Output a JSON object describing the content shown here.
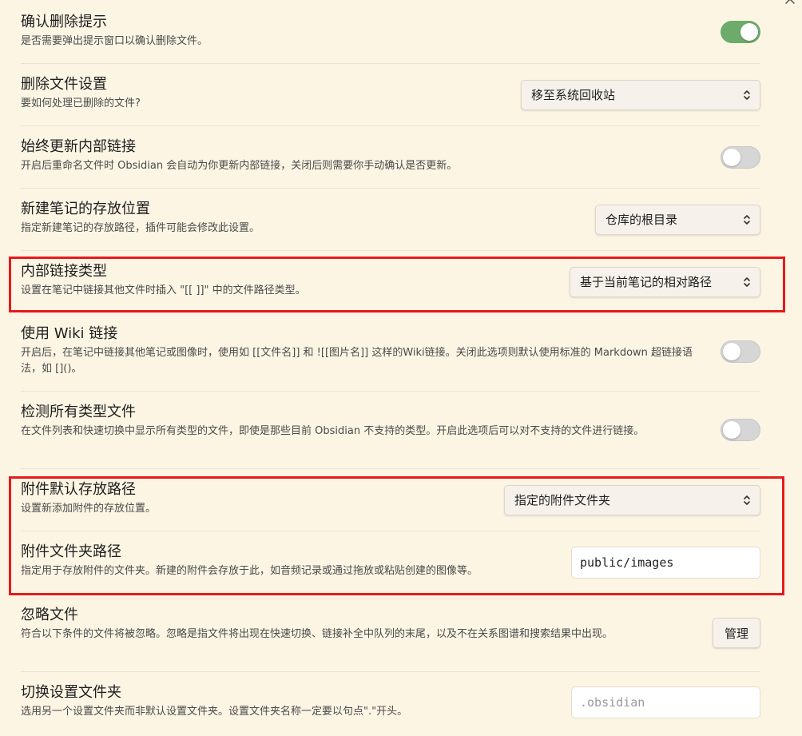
{
  "settings": [
    {
      "name": "确认删除提示",
      "desc": "是否需要弹出提示窗口以确认删除文件。",
      "control": "toggle",
      "on": true
    },
    {
      "name": "删除文件设置",
      "desc": "要如何处理已删除的文件?",
      "control": "dropdown",
      "value": "移至系统回收站"
    },
    {
      "name": "始终更新内部链接",
      "desc": "开启后重命名文件时 Obsidian 会自动为你更新内部链接，关闭后则需要你手动确认是否更新。",
      "control": "toggle",
      "on": false
    },
    {
      "name": "新建笔记的存放位置",
      "desc": "指定新建笔记的存放路径，插件可能会修改此设置。",
      "control": "dropdown",
      "value": "仓库的根目录"
    },
    {
      "name": "内部链接类型",
      "desc": "设置在笔记中链接其他文件时插入 \"[[ ]]\" 中的文件路径类型。",
      "control": "dropdown",
      "value": "基于当前笔记的相对路径"
    },
    {
      "name": "使用 Wiki 链接",
      "desc": "开启后，在笔记中链接其他笔记或图像时，使用如 [[文件名]] 和 ![[图片名]] 这样的Wiki链接。关闭此选项则默认使用标准的 Markdown 超链接语法，如 []()。",
      "control": "toggle",
      "on": false
    },
    {
      "name": "检测所有类型文件",
      "desc": "在文件列表和快速切换中显示所有类型的文件，即使是那些目前 Obsidian 不支持的类型。开启此选项后可以对不支持的文件进行链接。",
      "control": "toggle",
      "on": false
    },
    {
      "name": "附件默认存放路径",
      "desc": "设置新添加附件的存放位置。",
      "control": "dropdown",
      "value": "指定的附件文件夹"
    },
    {
      "name": "附件文件夹路径",
      "desc": "指定用于存放附件的文件夹。新建的附件会存放于此，如音频记录或通过拖放或粘贴创建的图像等。",
      "control": "text",
      "value": "public/images",
      "placeholder": ""
    },
    {
      "name": "忽略文件",
      "desc": "符合以下条件的文件将被忽略。忽略是指文件将出现在快速切换、链接补全中队列的末尾，以及不在关系图谱和搜索结果中出现。",
      "control": "button",
      "value": "管理"
    },
    {
      "name": "切换设置文件夹",
      "desc": "选用另一个设置文件夹而非默认设置文件夹。设置文件夹名称一定要以句点\".\"开头。",
      "control": "text",
      "value": "",
      "placeholder": ".obsidian"
    }
  ],
  "colors": {
    "background": "#fcf5e4",
    "toggle_on": "#6cab6a",
    "toggle_off": "#d6d6d6",
    "highlight": "#e8191b"
  },
  "icons": {
    "dropdown": "chevron-up-down-icon",
    "scroll": "chevron-up-icon"
  }
}
